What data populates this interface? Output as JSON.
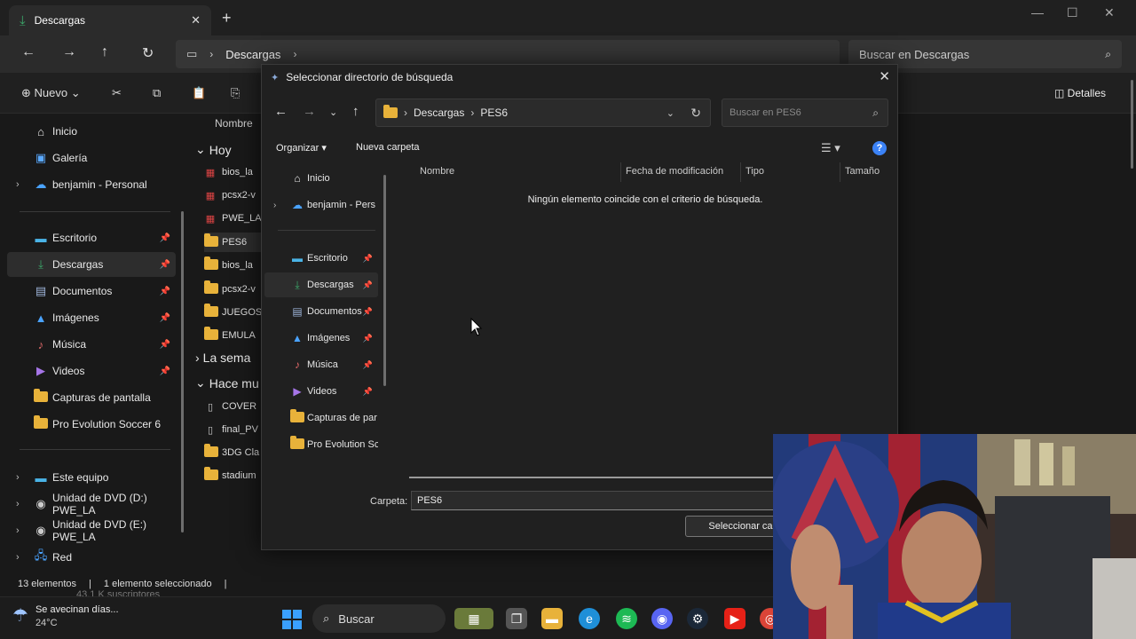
{
  "explorer": {
    "tab_title": "Descargas",
    "nav": {
      "breadcrumb": [
        "Descargas"
      ],
      "search_placeholder": "Buscar en Descargas"
    },
    "toolbar": {
      "new_label": "Nuevo",
      "details_label": "Detalles"
    },
    "sidebar": {
      "top": [
        "Inicio",
        "Galería",
        "benjamin - Personal"
      ],
      "quick": [
        "Escritorio",
        "Descargas",
        "Documentos",
        "Imágenes",
        "Música",
        "Videos",
        "Capturas de pantalla",
        "Pro Evolution Soccer 6"
      ],
      "bottom": [
        "Este equipo",
        "Unidad de DVD (D:) PWE_LA",
        "Unidad de DVD (E:) PWE_LA",
        "Red"
      ]
    },
    "list": {
      "column_name": "Nombre",
      "group_today": "Hoy",
      "group_week": "La sema",
      "group_long": "Hace mu",
      "today_items": [
        "bios_la",
        "pcsx2-v",
        "PWE_LA",
        "PES6",
        "bios_la",
        "pcsx2-v",
        "JUEGOS",
        "EMULA"
      ],
      "old_items": [
        "COVER",
        "final_PV",
        "3DG Cla",
        "stadium"
      ]
    },
    "status": {
      "count": "13 elementos",
      "selected": "1 elemento seleccionado"
    }
  },
  "dialog": {
    "title": "Seleccionar directorio de búsqueda",
    "breadcrumb": [
      "Descargas",
      "PES6"
    ],
    "search_placeholder": "Buscar en PES6",
    "organize_label": "Organizar",
    "new_folder_label": "Nueva carpeta",
    "help_label": "?",
    "sidebar": {
      "top": [
        "Inicio",
        "benjamin - Pers"
      ],
      "quick": [
        "Escritorio",
        "Descargas",
        "Documentos",
        "Imágenes",
        "Música",
        "Videos",
        "Capturas de par",
        "Pro Evolution Sc"
      ]
    },
    "columns": [
      "Nombre",
      "Fecha de modificación",
      "Tipo",
      "Tamaño"
    ],
    "empty_message": "Ningún elemento coincide con el criterio de búsqueda.",
    "folder_label": "Carpeta:",
    "folder_value": "PES6",
    "select_button": "Seleccionar carpeta"
  },
  "taskbar": {
    "weather_text": "Se avecinan días...",
    "temperature": "24°C",
    "search_label": "Buscar",
    "behind_text": "43.1 K suscriptores"
  },
  "colors": {
    "accent": "#3b82f6",
    "folder": "#e8b23a",
    "download": "#3ca86a"
  }
}
